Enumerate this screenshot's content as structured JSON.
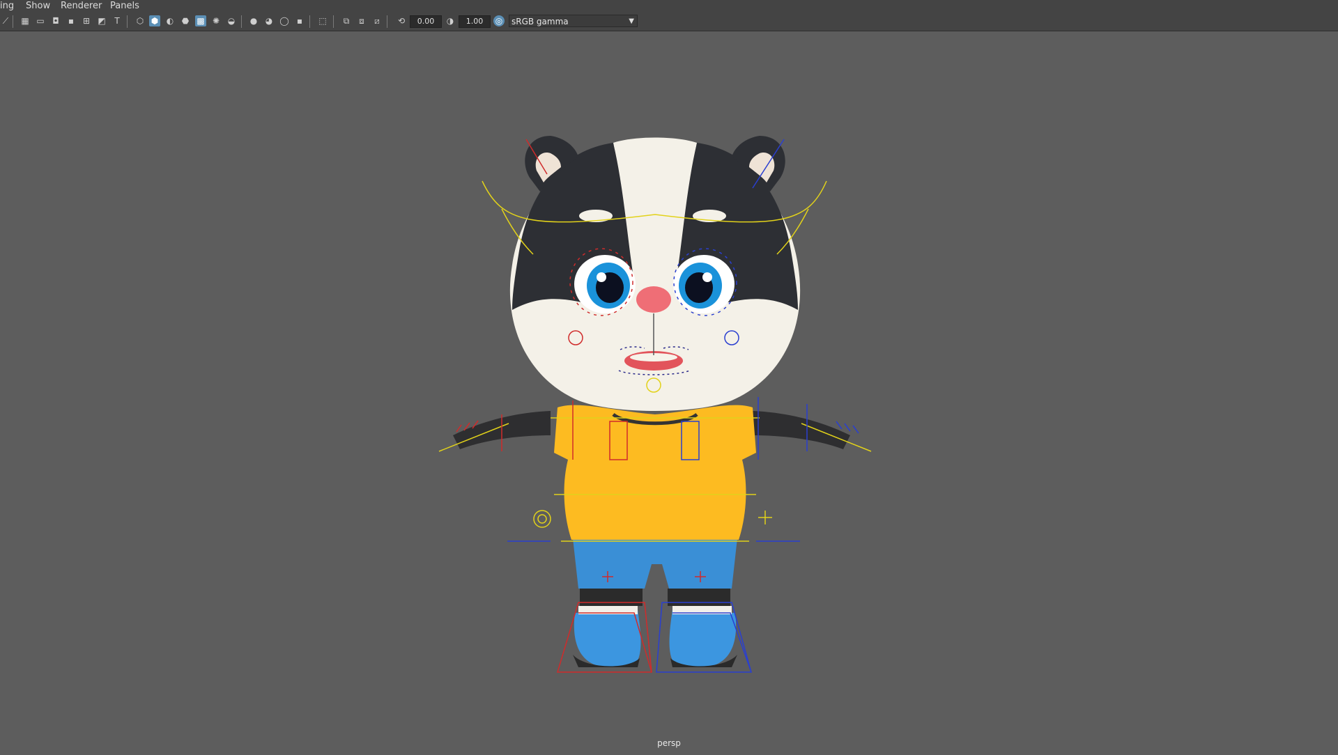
{
  "menu": {
    "items": [
      "ing",
      "Show",
      "Renderer",
      "Panels"
    ]
  },
  "toolbar": {
    "icons": [
      "select-camera-icon",
      "camera-attributes-icon",
      "bookmarks-icon",
      "image-plane-icon",
      "grid-icon",
      "film-gate-icon",
      "resolution-gate-icon",
      "gate-mask-icon",
      "field-chart-icon",
      "safe-action-icon",
      "safe-title-icon",
      "wireframe-icon",
      "smooth-shade-icon",
      "default-material-icon",
      "wireframe-on-shaded-icon",
      "textured-icon",
      "use-lights-icon",
      "shadows-icon",
      "screen-space-ao-icon",
      "motion-blur-icon",
      "anti-aliasing-icon",
      "depth-of-field-icon",
      "isolate-select-icon",
      "xray-icon",
      "xray-joints-icon",
      "xray-components-icon",
      "exposure-icon",
      "gamma-icon",
      "color-management-icon"
    ],
    "exposure_value": "0.00",
    "gamma_value": "1.00",
    "color_space": "sRGB gamma"
  },
  "viewport": {
    "background": "#5d5d5d",
    "camera_label": "persp"
  }
}
